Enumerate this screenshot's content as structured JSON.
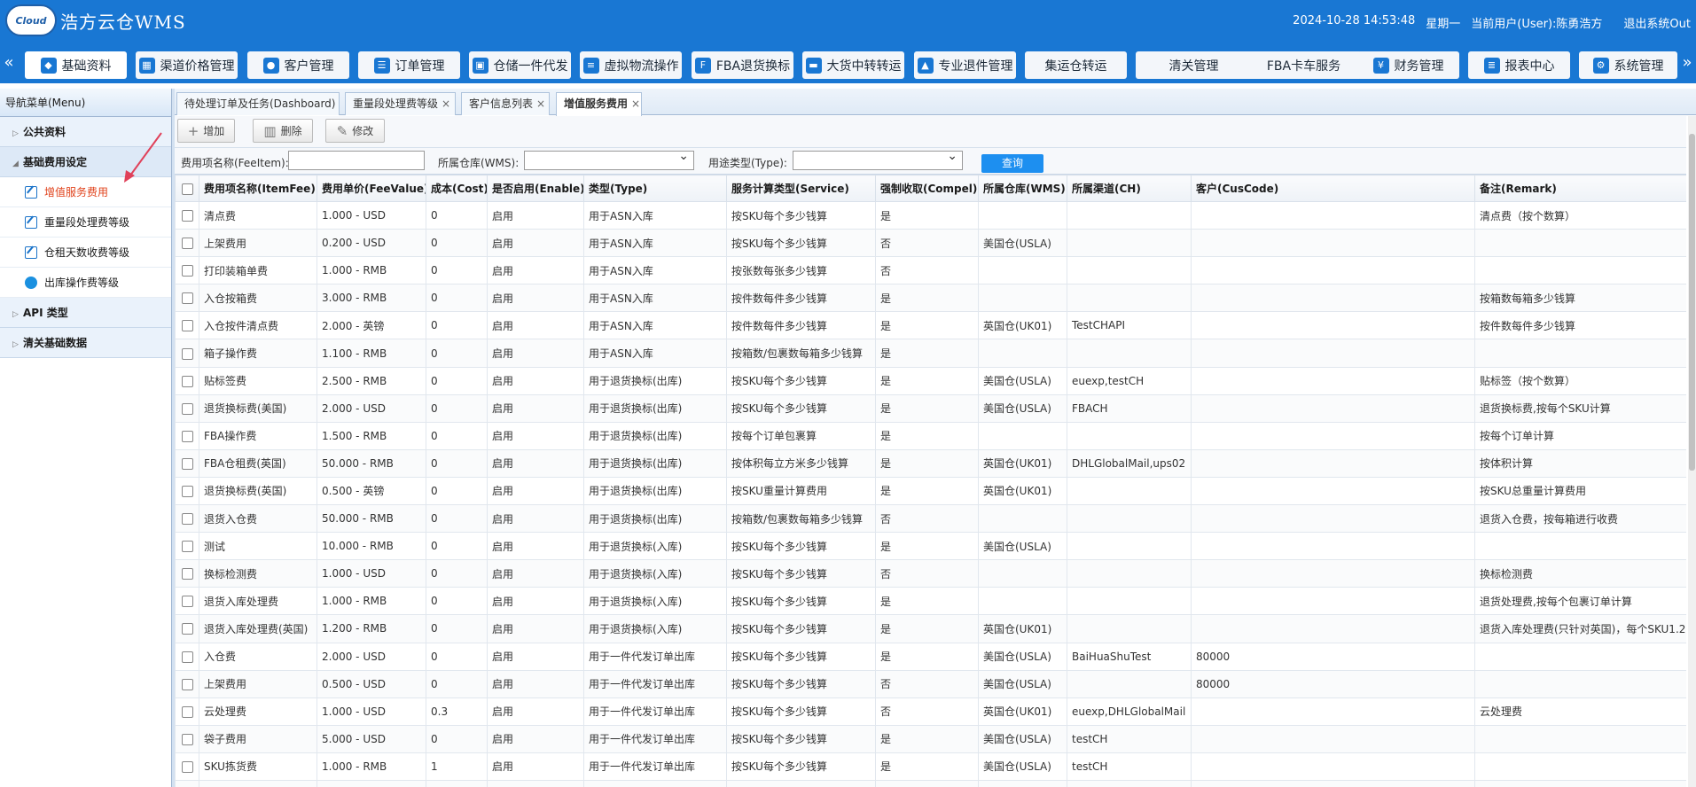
{
  "app": {
    "logo_badge": "Cloud",
    "logo_text": "浩方云仓WMS",
    "datetime": "2024-10-28 14:53:48",
    "weekday": "星期一",
    "current_user": "当前用户(User):陈勇浩方",
    "logout": "退出系统Out"
  },
  "topnav": {
    "left_arrow": "«",
    "right_arrow": "»",
    "items": [
      {
        "label": "基础资料",
        "icon": "tag-icon"
      },
      {
        "label": "渠道价格管理",
        "icon": "image-icon"
      },
      {
        "label": "客户管理",
        "icon": "user-icon"
      },
      {
        "label": "订单管理",
        "icon": "list-icon"
      },
      {
        "label": "仓储一件代发",
        "icon": "box-icon"
      },
      {
        "label": "虚拟物流操作",
        "icon": "bars-icon"
      },
      {
        "label": "FBA退货换标",
        "icon": "fba-icon"
      },
      {
        "label": "大货中转转运",
        "icon": "truck-icon"
      },
      {
        "label": "专业退件管理",
        "icon": "car-icon"
      },
      {
        "label": "集运仓转运",
        "icon": ""
      },
      {
        "label": "清关管理",
        "icon": ""
      },
      {
        "label": "FBA卡车服务",
        "icon": ""
      },
      {
        "label": "财务管理",
        "icon": "finance-icon"
      },
      {
        "label": "报表中心",
        "icon": "database-icon"
      },
      {
        "label": "系统管理",
        "icon": "system-icon"
      }
    ]
  },
  "sidebar": {
    "title": "导航菜单(Menu)",
    "sections": {
      "public": "公共资料",
      "fee_settings": "基础费用设定",
      "api": "API 类型",
      "customs": "清关基础数据"
    },
    "items": [
      {
        "label": "增值服务费用",
        "active": true
      },
      {
        "label": "重量段处理费等级",
        "active": false
      },
      {
        "label": "仓租天数收费等级",
        "active": false
      },
      {
        "label": "出库操作费等级",
        "active": false
      }
    ]
  },
  "tabs": [
    {
      "label": "待处理订单及任务(Dashboard)"
    },
    {
      "label": "重量段处理费等级",
      "close": "×"
    },
    {
      "label": "客户信息列表",
      "close": "×"
    },
    {
      "label": "增值服务费用",
      "close": "×"
    }
  ],
  "toolbar": {
    "add": "增加",
    "delete": "删除",
    "edit": "修改"
  },
  "search": {
    "fee_item_label": "费用项名称(FeeItem):",
    "fee_item_value": "",
    "warehouse_label": "所属仓库(WMS):",
    "warehouse_value": "",
    "type_label": "用途类型(Type):",
    "type_value": "",
    "query_button": "查询"
  },
  "table": {
    "headers": [
      "费用项名称(ItemFee)",
      "费用单价(FeeValue)",
      "成本(Cost)",
      "是否启用(Enable)",
      "类型(Type)",
      "服务计算类型(Service)",
      "强制收取(Compel)",
      "所属仓库(WMS)",
      "所属渠道(CH)",
      "客户(CusCode)",
      "备注(Remark)"
    ],
    "rows": [
      [
        "清点费",
        "1.000 - USD",
        "0",
        "启用",
        "用于ASN入库",
        "按SKU每个多少钱算",
        "是",
        "",
        "",
        "",
        "清点费（按个数算）"
      ],
      [
        "上架费用",
        "0.200 - USD",
        "0",
        "启用",
        "用于ASN入库",
        "按SKU每个多少钱算",
        "否",
        "美国仓(USLA)",
        "",
        "",
        ""
      ],
      [
        "打印装箱单费",
        "1.000 - RMB",
        "0",
        "启用",
        "用于ASN入库",
        "按张数每张多少钱算",
        "否",
        "",
        "",
        "",
        ""
      ],
      [
        "入仓按箱费",
        "3.000 - RMB",
        "0",
        "启用",
        "用于ASN入库",
        "按件数每件多少钱算",
        "是",
        "",
        "",
        "",
        "按箱数每箱多少钱算"
      ],
      [
        "入仓按件清点费",
        "2.000 - 英镑",
        "0",
        "启用",
        "用于ASN入库",
        "按件数每件多少钱算",
        "是",
        "英国仓(UK01)",
        "TestCHAPI",
        "",
        "按件数每件多少钱算"
      ],
      [
        "箱子操作费",
        "1.100 - RMB",
        "0",
        "启用",
        "用于ASN入库",
        "按箱数/包裹数每箱多少钱算",
        "是",
        "",
        "",
        "",
        ""
      ],
      [
        "贴标签费",
        "2.500 - RMB",
        "0",
        "启用",
        "用于退货换标(出库)",
        "按SKU每个多少钱算",
        "是",
        "美国仓(USLA)",
        "euexp,testCH",
        "",
        "贴标签（按个数算）"
      ],
      [
        "退货换标费(美国)",
        "2.000 - USD",
        "0",
        "启用",
        "用于退货换标(出库)",
        "按SKU每个多少钱算",
        "是",
        "美国仓(USLA)",
        "FBACH",
        "",
        "退货换标费,按每个SKU计算"
      ],
      [
        "FBA操作费",
        "1.500 - RMB",
        "0",
        "启用",
        "用于退货换标(出库)",
        "按每个订单包裹算",
        "是",
        "",
        "",
        "",
        "按每个订单计算"
      ],
      [
        "FBA仓租费(英国)",
        "50.000 - RMB",
        "0",
        "启用",
        "用于退货换标(出库)",
        "按体积每立方米多少钱算",
        "是",
        "英国仓(UK01)",
        "DHLGlobalMail,ups02",
        "",
        "按体积计算"
      ],
      [
        "退货换标费(英国)",
        "0.500 - 英镑",
        "0",
        "启用",
        "用于退货换标(出库)",
        "按SKU重量计算费用",
        "是",
        "英国仓(UK01)",
        "",
        "",
        "按SKU总重量计算费用"
      ],
      [
        "退货入仓费",
        "50.000 - RMB",
        "0",
        "启用",
        "用于退货换标(出库)",
        "按箱数/包裹数每箱多少钱算",
        "否",
        "",
        "",
        "",
        "退货入仓费，按每箱进行收费"
      ],
      [
        "测试",
        "10.000 - RMB",
        "0",
        "启用",
        "用于退货换标(入库)",
        "按SKU每个多少钱算",
        "是",
        "美国仓(USLA)",
        "",
        "",
        ""
      ],
      [
        "换标检测费",
        "1.000 - USD",
        "0",
        "启用",
        "用于退货换标(入库)",
        "按SKU每个多少钱算",
        "否",
        "",
        "",
        "",
        "换标检测费"
      ],
      [
        "退货入库处理费",
        "1.000 - RMB",
        "0",
        "启用",
        "用于退货换标(入库)",
        "按SKU每个多少钱算",
        "是",
        "",
        "",
        "",
        "退货处理费,按每个包裹订单计算"
      ],
      [
        "退货入库处理费(英国)",
        "1.200 - RMB",
        "0",
        "启用",
        "用于退货换标(入库)",
        "按SKU每个多少钱算",
        "是",
        "英国仓(UK01)",
        "",
        "",
        "退货入库处理费(只针对英国)，每个SKU1.2"
      ],
      [
        "入仓费",
        "2.000 - USD",
        "0",
        "启用",
        "用于一件代发订单出库",
        "按SKU每个多少钱算",
        "是",
        "美国仓(USLA)",
        "BaiHuaShuTest",
        "80000",
        ""
      ],
      [
        "上架费用",
        "0.500 - USD",
        "0",
        "启用",
        "用于一件代发订单出库",
        "按SKU每个多少钱算",
        "否",
        "美国仓(USLA)",
        "",
        "80000",
        ""
      ],
      [
        "云处理费",
        "1.000 - USD",
        "0.3",
        "启用",
        "用于一件代发订单出库",
        "按SKU每个多少钱算",
        "否",
        "英国仓(UK01)",
        "euexp,DHLGlobalMail",
        "",
        "云处理费"
      ],
      [
        "袋子费用",
        "5.000 - USD",
        "0",
        "启用",
        "用于一件代发订单出库",
        "按SKU每个多少钱算",
        "是",
        "美国仓(USLA)",
        "testCH",
        "",
        ""
      ],
      [
        "SKU拣货费",
        "1.000 - RMB",
        "1",
        "启用",
        "用于一件代发订单出库",
        "按SKU每个多少钱算",
        "是",
        "美国仓(USLA)",
        "testCH",
        "",
        ""
      ],
      [
        "",
        "",
        "",
        "",
        "",
        "",
        "",
        "",
        "",
        "",
        ""
      ]
    ]
  },
  "colors": {
    "header_bg": "#1977d3",
    "active_menu": "#e0421b",
    "query_button": "#1d8ff0"
  }
}
